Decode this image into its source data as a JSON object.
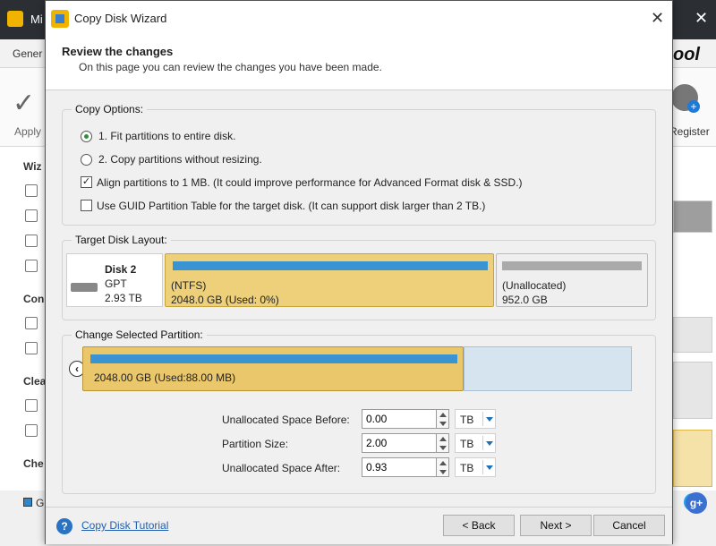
{
  "background_app": {
    "title": "Mi",
    "menu_fragment": "Gener",
    "brand_fragment": "ool",
    "apply_label": "Apply",
    "register_label": "Register",
    "sidebar_sections": [
      "Wiz",
      "Con",
      "Clea",
      "Che"
    ],
    "legend_fragment": "G"
  },
  "dialog": {
    "title": "Copy Disk Wizard",
    "close_glyph": "✕",
    "heading": "Review the changes",
    "subheading": "On this page you can review the changes you have been made."
  },
  "copy_options": {
    "legend": "Copy Options:",
    "option1": "1. Fit partitions to entire disk.",
    "option2": "2. Copy partitions without resizing.",
    "align": "Align partitions to 1 MB.  (It could improve performance for Advanced Format disk & SSD.)",
    "guid": "Use GUID Partition Table for the target disk. (It can support disk larger than 2 TB.)",
    "selected_option": 1,
    "align_checked": true,
    "guid_checked": false
  },
  "target_layout": {
    "legend": "Target Disk Layout:",
    "disk_name": "Disk 2",
    "disk_type": "GPT",
    "disk_size": "2.93 TB",
    "ntfs_label": "(NTFS)",
    "ntfs_size": "2048.0 GB (Used: 0%)",
    "unalloc_label": "(Unallocated)",
    "unalloc_size": "952.0 GB"
  },
  "change_partition": {
    "legend": "Change Selected Partition:",
    "left_arrow": "‹",
    "right_arrow": "›",
    "partition_label": "2048.00 GB (Used:88.00 MB)",
    "before_label": "Unallocated Space Before:",
    "before_value": "0.00",
    "size_label": "Partition Size:",
    "size_value": "2.00",
    "after_label": "Unallocated Space After:",
    "after_value": "0.93",
    "unit": "TB"
  },
  "footer": {
    "help_glyph": "?",
    "tutorial_link": "Copy Disk Tutorial",
    "back_label": "< Back",
    "next_label": "Next >",
    "cancel_label": "Cancel"
  },
  "colors": {
    "ntfs_fill": "#edd079",
    "bar_blue": "#3a93d2",
    "unallocated": "#efefef",
    "radio_selected": "#2f8f3a"
  }
}
